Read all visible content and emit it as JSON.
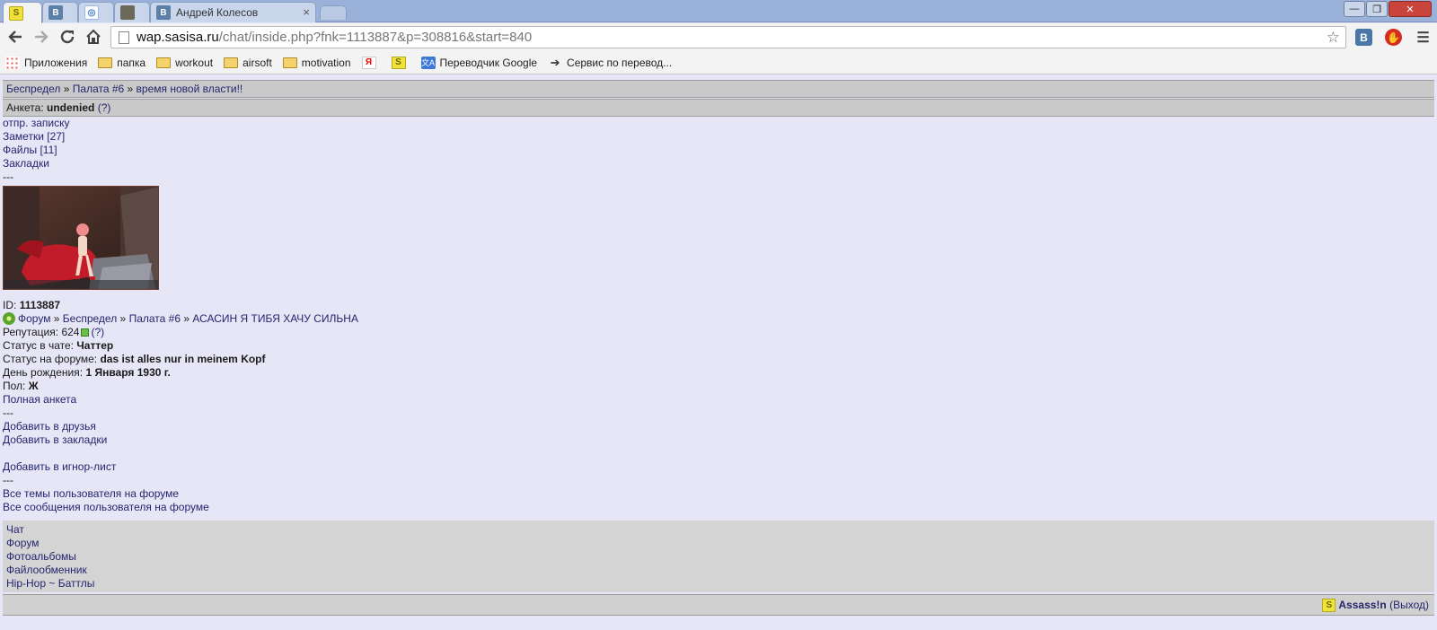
{
  "browser": {
    "tabs": [
      {
        "icon": "sasisa-icon",
        "icon_text": "S",
        "title": ""
      },
      {
        "icon": "vk-icon",
        "icon_text": "В",
        "title": ""
      },
      {
        "icon": "globe-icon",
        "icon_text": "◎",
        "title": ""
      },
      {
        "icon": "image-icon",
        "icon_text": "",
        "title": ""
      },
      {
        "icon": "vk-icon",
        "icon_text": "В",
        "title": "Андрей Колесов"
      }
    ],
    "tab_close": "×",
    "window_buttons": {
      "minimize": "—",
      "maximize": "❐",
      "close": "✕"
    },
    "url_host": "wap.sasisa.ru",
    "url_path": "/chat/inside.php?fnk=1113887&p=308816&start=840",
    "bookmarks": [
      {
        "icon": "apps-icon",
        "label": "Приложения"
      },
      {
        "icon": "folder-icon",
        "label": "папка"
      },
      {
        "icon": "folder-icon",
        "label": "workout"
      },
      {
        "icon": "folder-icon",
        "label": "airsoft"
      },
      {
        "icon": "folder-icon",
        "label": "motivation"
      },
      {
        "icon": "yandex-icon",
        "icon_text": "Я",
        "label": ""
      },
      {
        "icon": "sasisa-icon",
        "icon_text": "S",
        "label": ""
      },
      {
        "icon": "translate-icon",
        "icon_text": "文A",
        "label": "Переводчик Google"
      },
      {
        "icon": "arrow-icon",
        "icon_text": "➔",
        "label": "Сервис по перевод..."
      }
    ],
    "extensions": [
      {
        "icon": "vk-extension-icon",
        "text": "В",
        "color": "#4a76a8"
      },
      {
        "icon": "adblock-icon",
        "text": "✋",
        "color": "#d62b20"
      }
    ]
  },
  "breadcrumb": {
    "items": [
      "Беспредел",
      "Палата #6",
      "время новой власти!!"
    ],
    "sep": " » "
  },
  "profile_header": {
    "label": "Анкета:",
    "username": "undenied",
    "help": "(?)"
  },
  "actions_top": [
    "отпр. записку",
    "Заметки [27]",
    "Файлы [11]",
    "Закладки",
    "---"
  ],
  "profile": {
    "id_label": "ID:",
    "id_value": "1113887",
    "forum_path": [
      "Форум",
      "Беспредел",
      "Палата #6",
      "АСАСИН Я ТИБЯ ХАЧУ СИЛЬНА"
    ],
    "reputation_label": "Репутация:",
    "reputation_value": "624",
    "reputation_help": "(?)",
    "chat_status_label": "Статус в чате:",
    "chat_status_value": "Чаттер",
    "forum_status_label": "Статус на форуме:",
    "forum_status_value": "das ist alles nur in meinem Kopf",
    "birthday_label": "День рождения:",
    "birthday_value": "1 Января 1930 г.",
    "gender_label": "Пол:",
    "gender_value": "Ж",
    "full_profile": "Полная анкета"
  },
  "actions_bottom": {
    "sep1": "---",
    "add_friend": "Добавить в друзья",
    "add_bookmark": "Добавить в закладки",
    "add_ignore": "Добавить в игнор-лист",
    "sep2": "---",
    "all_topics": "Все темы пользователя на форуме",
    "all_messages": "Все сообщения пользователя на форуме"
  },
  "menu": [
    "Чат",
    "Форум",
    "Фотоальбомы",
    "Файлообменник",
    "Hip-Hop ~ Баттлы"
  ],
  "footer": {
    "icon_text": "S",
    "user": "Assass!n",
    "logout": "(Выход)"
  }
}
